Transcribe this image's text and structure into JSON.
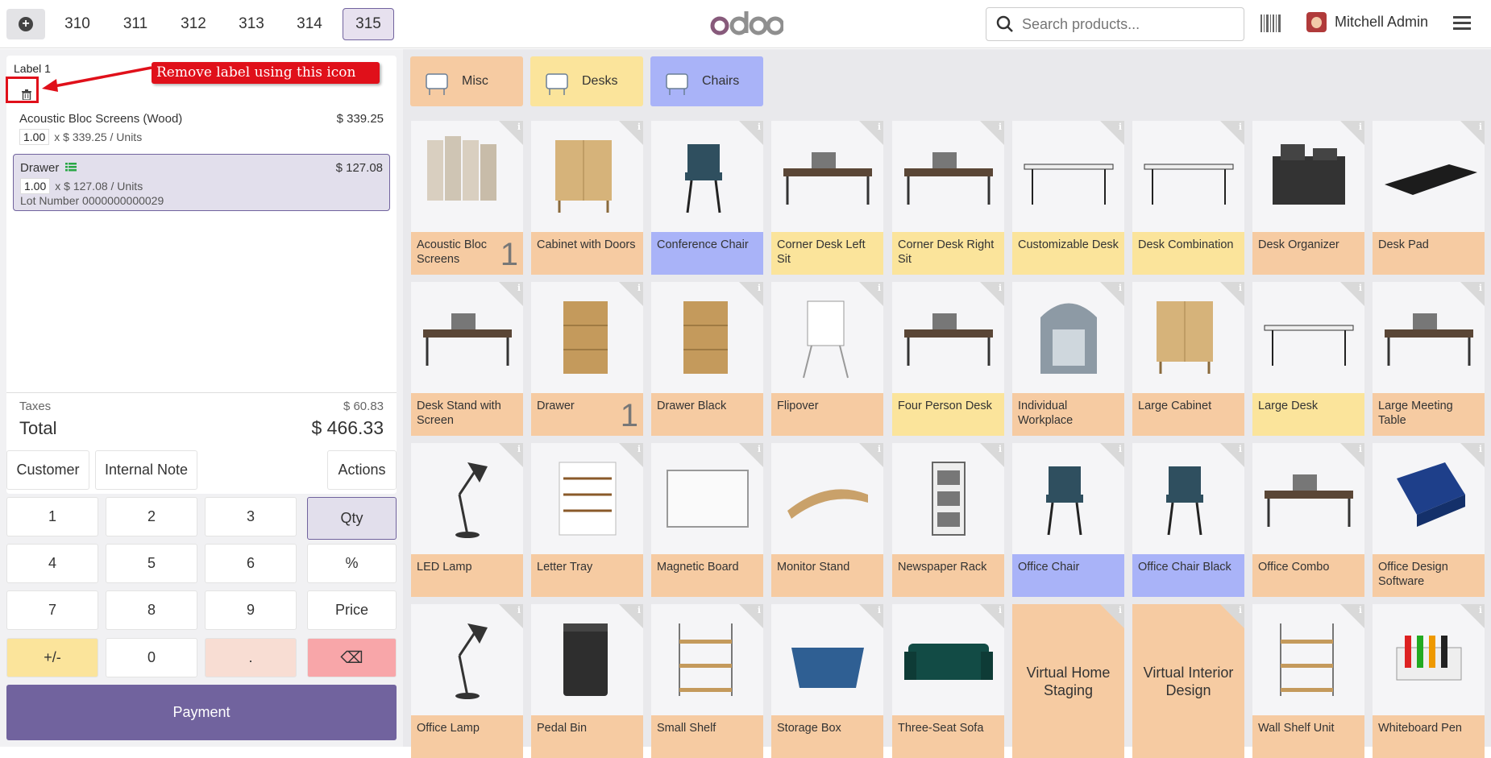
{
  "topbar": {
    "order_tabs": [
      "310",
      "311",
      "312",
      "313",
      "314",
      "315"
    ],
    "active_tab": "315",
    "logo": "odoo",
    "search_placeholder": "Search products...",
    "user_name": "Mitchell Admin"
  },
  "order": {
    "label": "Label 1",
    "annotation": "Remove label using this icon",
    "lines": [
      {
        "name": "Acoustic Bloc Screens (Wood)",
        "price": "$ 339.25",
        "qty": "1.00",
        "unit_text": "x $ 339.25 / Units"
      },
      {
        "name": "Drawer",
        "price": "$ 127.08",
        "qty": "1.00",
        "unit_text": "x $ 127.08 / Units",
        "lot": "Lot Number 0000000000029"
      }
    ],
    "taxes_label": "Taxes",
    "taxes_value": "$ 60.83",
    "total_label": "Total",
    "total_value": "$ 466.33"
  },
  "controls": {
    "customer": "Customer",
    "internal_note": "Internal Note",
    "actions": "Actions"
  },
  "numpad": {
    "keys": [
      "1",
      "2",
      "3",
      "Qty",
      "4",
      "5",
      "6",
      "%",
      "7",
      "8",
      "9",
      "Price",
      "+/-",
      "0",
      ".",
      "⌫"
    ],
    "active_mode": "Qty"
  },
  "payment_label": "Payment",
  "categories": [
    {
      "name": "Misc",
      "color": "#f6cba2"
    },
    {
      "name": "Desks",
      "color": "#fbe49b"
    },
    {
      "name": "Chairs",
      "color": "#a9b3f8"
    }
  ],
  "products": [
    {
      "name": "Acoustic Bloc Screens",
      "color": "#f6cba2",
      "qty": "1",
      "icon": "screen-panel-icon"
    },
    {
      "name": "Cabinet with Doors",
      "color": "#f6cba2",
      "qty": "",
      "icon": "cabinet-icon"
    },
    {
      "name": "Conference Chair",
      "color": "#a9b3f8",
      "qty": "",
      "icon": "chair-icon"
    },
    {
      "name": "Corner Desk Left Sit",
      "color": "#fbe49b",
      "qty": "",
      "icon": "desk-icon"
    },
    {
      "name": "Corner Desk Right Sit",
      "color": "#fbe49b",
      "qty": "",
      "icon": "desk-icon"
    },
    {
      "name": "Customizable Desk",
      "color": "#fbe49b",
      "qty": "",
      "icon": "table-icon"
    },
    {
      "name": "Desk Combination",
      "color": "#fbe49b",
      "qty": "",
      "icon": "table-icon"
    },
    {
      "name": "Desk Organizer",
      "color": "#f6cba2",
      "qty": "",
      "icon": "organizer-icon"
    },
    {
      "name": "Desk Pad",
      "color": "#f6cba2",
      "qty": "",
      "icon": "pad-icon"
    },
    {
      "name": "Desk Stand with Screen",
      "color": "#f6cba2",
      "qty": "",
      "icon": "desk-icon"
    },
    {
      "name": "Drawer",
      "color": "#f6cba2",
      "qty": "1",
      "icon": "drawer-icon"
    },
    {
      "name": "Drawer Black",
      "color": "#f6cba2",
      "qty": "",
      "icon": "drawer-icon"
    },
    {
      "name": "Flipover",
      "color": "#f6cba2",
      "qty": "",
      "icon": "flipchart-icon"
    },
    {
      "name": "Four Person Desk",
      "color": "#fbe49b",
      "qty": "",
      "icon": "desk-icon"
    },
    {
      "name": "Individual Workplace",
      "color": "#f6cba2",
      "qty": "",
      "icon": "pod-icon"
    },
    {
      "name": "Large Cabinet",
      "color": "#f6cba2",
      "qty": "",
      "icon": "cabinet-icon"
    },
    {
      "name": "Large Desk",
      "color": "#fbe49b",
      "qty": "",
      "icon": "table-icon"
    },
    {
      "name": "Large Meeting Table",
      "color": "#f6cba2",
      "qty": "",
      "icon": "desk-icon"
    },
    {
      "name": "LED Lamp",
      "color": "#f6cba2",
      "qty": "",
      "icon": "lamp-icon"
    },
    {
      "name": "Letter Tray",
      "color": "#f6cba2",
      "qty": "",
      "icon": "tray-icon"
    },
    {
      "name": "Magnetic Board",
      "color": "#f6cba2",
      "qty": "",
      "icon": "board-icon"
    },
    {
      "name": "Monitor Stand",
      "color": "#f6cba2",
      "qty": "",
      "icon": "stand-icon"
    },
    {
      "name": "Newspaper Rack",
      "color": "#f6cba2",
      "qty": "",
      "icon": "rack-icon"
    },
    {
      "name": "Office Chair",
      "color": "#a9b3f8",
      "qty": "",
      "icon": "chair-icon"
    },
    {
      "name": "Office Chair Black",
      "color": "#a9b3f8",
      "qty": "",
      "icon": "chair-icon"
    },
    {
      "name": "Office Combo",
      "color": "#f6cba2",
      "qty": "",
      "icon": "desk-icon"
    },
    {
      "name": "Office Design Software",
      "color": "#f6cba2",
      "qty": "",
      "icon": "software-box-icon"
    },
    {
      "name": "Office Lamp",
      "color": "#f6cba2",
      "qty": "",
      "icon": "lamp-icon"
    },
    {
      "name": "Pedal Bin",
      "color": "#f6cba2",
      "qty": "",
      "icon": "bin-icon"
    },
    {
      "name": "Small Shelf",
      "color": "#f6cba2",
      "qty": "",
      "icon": "shelf-icon"
    },
    {
      "name": "Storage Box",
      "color": "#f6cba2",
      "qty": "",
      "icon": "box-icon"
    },
    {
      "name": "Three-Seat Sofa",
      "color": "#f6cba2",
      "qty": "",
      "icon": "sofa-icon"
    },
    {
      "name": "Virtual Home Staging",
      "color": "#f6cba2",
      "qty": "",
      "icon": "",
      "text_only": true
    },
    {
      "name": "Virtual Interior Design",
      "color": "#f6cba2",
      "qty": "",
      "icon": "",
      "text_only": true
    },
    {
      "name": "Wall Shelf Unit",
      "color": "#f6cba2",
      "qty": "",
      "icon": "shelf-icon"
    },
    {
      "name": "Whiteboard Pen",
      "color": "#f6cba2",
      "qty": "",
      "icon": "pen-icon"
    }
  ]
}
